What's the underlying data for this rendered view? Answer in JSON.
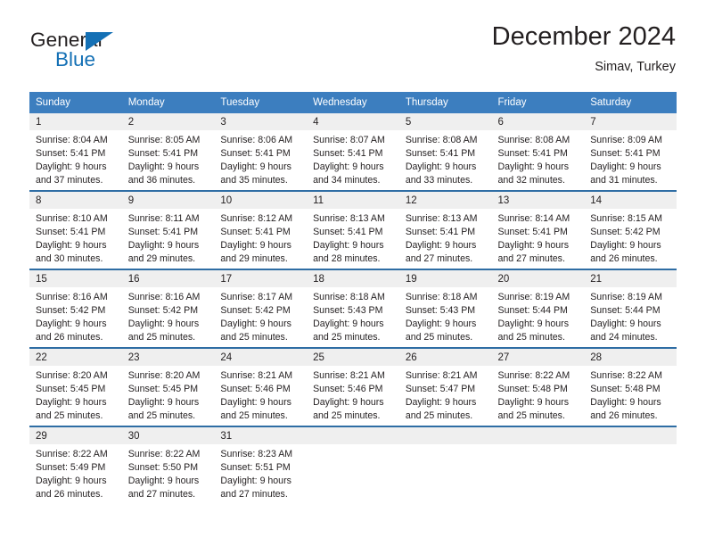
{
  "brand": {
    "name_primary": "General",
    "name_secondary": "Blue",
    "accent_color": "#1470b5"
  },
  "header": {
    "title": "December 2024",
    "location": "Simav, Turkey"
  },
  "theme": {
    "header_row_color": "#3c7ebf",
    "week_divider_color": "#2e6da4",
    "day_number_band_color": "#efefef",
    "text_color": "#231f20"
  },
  "calendar": {
    "weekday_headers": [
      "Sunday",
      "Monday",
      "Tuesday",
      "Wednesday",
      "Thursday",
      "Friday",
      "Saturday"
    ],
    "weeks": [
      [
        {
          "day": "1",
          "sunrise": "Sunrise: 8:04 AM",
          "sunset": "Sunset: 5:41 PM",
          "daylight_line1": "Daylight: 9 hours",
          "daylight_line2": "and 37 minutes."
        },
        {
          "day": "2",
          "sunrise": "Sunrise: 8:05 AM",
          "sunset": "Sunset: 5:41 PM",
          "daylight_line1": "Daylight: 9 hours",
          "daylight_line2": "and 36 minutes."
        },
        {
          "day": "3",
          "sunrise": "Sunrise: 8:06 AM",
          "sunset": "Sunset: 5:41 PM",
          "daylight_line1": "Daylight: 9 hours",
          "daylight_line2": "and 35 minutes."
        },
        {
          "day": "4",
          "sunrise": "Sunrise: 8:07 AM",
          "sunset": "Sunset: 5:41 PM",
          "daylight_line1": "Daylight: 9 hours",
          "daylight_line2": "and 34 minutes."
        },
        {
          "day": "5",
          "sunrise": "Sunrise: 8:08 AM",
          "sunset": "Sunset: 5:41 PM",
          "daylight_line1": "Daylight: 9 hours",
          "daylight_line2": "and 33 minutes."
        },
        {
          "day": "6",
          "sunrise": "Sunrise: 8:08 AM",
          "sunset": "Sunset: 5:41 PM",
          "daylight_line1": "Daylight: 9 hours",
          "daylight_line2": "and 32 minutes."
        },
        {
          "day": "7",
          "sunrise": "Sunrise: 8:09 AM",
          "sunset": "Sunset: 5:41 PM",
          "daylight_line1": "Daylight: 9 hours",
          "daylight_line2": "and 31 minutes."
        }
      ],
      [
        {
          "day": "8",
          "sunrise": "Sunrise: 8:10 AM",
          "sunset": "Sunset: 5:41 PM",
          "daylight_line1": "Daylight: 9 hours",
          "daylight_line2": "and 30 minutes."
        },
        {
          "day": "9",
          "sunrise": "Sunrise: 8:11 AM",
          "sunset": "Sunset: 5:41 PM",
          "daylight_line1": "Daylight: 9 hours",
          "daylight_line2": "and 29 minutes."
        },
        {
          "day": "10",
          "sunrise": "Sunrise: 8:12 AM",
          "sunset": "Sunset: 5:41 PM",
          "daylight_line1": "Daylight: 9 hours",
          "daylight_line2": "and 29 minutes."
        },
        {
          "day": "11",
          "sunrise": "Sunrise: 8:13 AM",
          "sunset": "Sunset: 5:41 PM",
          "daylight_line1": "Daylight: 9 hours",
          "daylight_line2": "and 28 minutes."
        },
        {
          "day": "12",
          "sunrise": "Sunrise: 8:13 AM",
          "sunset": "Sunset: 5:41 PM",
          "daylight_line1": "Daylight: 9 hours",
          "daylight_line2": "and 27 minutes."
        },
        {
          "day": "13",
          "sunrise": "Sunrise: 8:14 AM",
          "sunset": "Sunset: 5:41 PM",
          "daylight_line1": "Daylight: 9 hours",
          "daylight_line2": "and 27 minutes."
        },
        {
          "day": "14",
          "sunrise": "Sunrise: 8:15 AM",
          "sunset": "Sunset: 5:42 PM",
          "daylight_line1": "Daylight: 9 hours",
          "daylight_line2": "and 26 minutes."
        }
      ],
      [
        {
          "day": "15",
          "sunrise": "Sunrise: 8:16 AM",
          "sunset": "Sunset: 5:42 PM",
          "daylight_line1": "Daylight: 9 hours",
          "daylight_line2": "and 26 minutes."
        },
        {
          "day": "16",
          "sunrise": "Sunrise: 8:16 AM",
          "sunset": "Sunset: 5:42 PM",
          "daylight_line1": "Daylight: 9 hours",
          "daylight_line2": "and 25 minutes."
        },
        {
          "day": "17",
          "sunrise": "Sunrise: 8:17 AM",
          "sunset": "Sunset: 5:42 PM",
          "daylight_line1": "Daylight: 9 hours",
          "daylight_line2": "and 25 minutes."
        },
        {
          "day": "18",
          "sunrise": "Sunrise: 8:18 AM",
          "sunset": "Sunset: 5:43 PM",
          "daylight_line1": "Daylight: 9 hours",
          "daylight_line2": "and 25 minutes."
        },
        {
          "day": "19",
          "sunrise": "Sunrise: 8:18 AM",
          "sunset": "Sunset: 5:43 PM",
          "daylight_line1": "Daylight: 9 hours",
          "daylight_line2": "and 25 minutes."
        },
        {
          "day": "20",
          "sunrise": "Sunrise: 8:19 AM",
          "sunset": "Sunset: 5:44 PM",
          "daylight_line1": "Daylight: 9 hours",
          "daylight_line2": "and 25 minutes."
        },
        {
          "day": "21",
          "sunrise": "Sunrise: 8:19 AM",
          "sunset": "Sunset: 5:44 PM",
          "daylight_line1": "Daylight: 9 hours",
          "daylight_line2": "and 24 minutes."
        }
      ],
      [
        {
          "day": "22",
          "sunrise": "Sunrise: 8:20 AM",
          "sunset": "Sunset: 5:45 PM",
          "daylight_line1": "Daylight: 9 hours",
          "daylight_line2": "and 25 minutes."
        },
        {
          "day": "23",
          "sunrise": "Sunrise: 8:20 AM",
          "sunset": "Sunset: 5:45 PM",
          "daylight_line1": "Daylight: 9 hours",
          "daylight_line2": "and 25 minutes."
        },
        {
          "day": "24",
          "sunrise": "Sunrise: 8:21 AM",
          "sunset": "Sunset: 5:46 PM",
          "daylight_line1": "Daylight: 9 hours",
          "daylight_line2": "and 25 minutes."
        },
        {
          "day": "25",
          "sunrise": "Sunrise: 8:21 AM",
          "sunset": "Sunset: 5:46 PM",
          "daylight_line1": "Daylight: 9 hours",
          "daylight_line2": "and 25 minutes."
        },
        {
          "day": "26",
          "sunrise": "Sunrise: 8:21 AM",
          "sunset": "Sunset: 5:47 PM",
          "daylight_line1": "Daylight: 9 hours",
          "daylight_line2": "and 25 minutes."
        },
        {
          "day": "27",
          "sunrise": "Sunrise: 8:22 AM",
          "sunset": "Sunset: 5:48 PM",
          "daylight_line1": "Daylight: 9 hours",
          "daylight_line2": "and 25 minutes."
        },
        {
          "day": "28",
          "sunrise": "Sunrise: 8:22 AM",
          "sunset": "Sunset: 5:48 PM",
          "daylight_line1": "Daylight: 9 hours",
          "daylight_line2": "and 26 minutes."
        }
      ],
      [
        {
          "day": "29",
          "sunrise": "Sunrise: 8:22 AM",
          "sunset": "Sunset: 5:49 PM",
          "daylight_line1": "Daylight: 9 hours",
          "daylight_line2": "and 26 minutes."
        },
        {
          "day": "30",
          "sunrise": "Sunrise: 8:22 AM",
          "sunset": "Sunset: 5:50 PM",
          "daylight_line1": "Daylight: 9 hours",
          "daylight_line2": "and 27 minutes."
        },
        {
          "day": "31",
          "sunrise": "Sunrise: 8:23 AM",
          "sunset": "Sunset: 5:51 PM",
          "daylight_line1": "Daylight: 9 hours",
          "daylight_line2": "and 27 minutes."
        },
        {
          "day": "",
          "sunrise": "",
          "sunset": "",
          "daylight_line1": "",
          "daylight_line2": ""
        },
        {
          "day": "",
          "sunrise": "",
          "sunset": "",
          "daylight_line1": "",
          "daylight_line2": ""
        },
        {
          "day": "",
          "sunrise": "",
          "sunset": "",
          "daylight_line1": "",
          "daylight_line2": ""
        },
        {
          "day": "",
          "sunrise": "",
          "sunset": "",
          "daylight_line1": "",
          "daylight_line2": ""
        }
      ]
    ]
  }
}
